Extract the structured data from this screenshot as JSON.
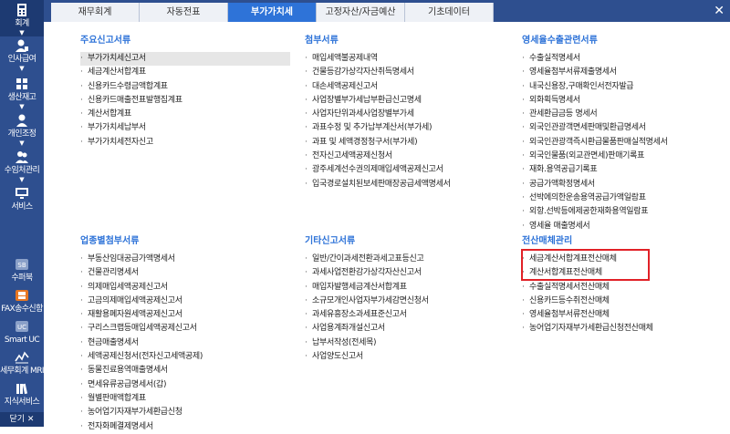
{
  "sidebar": {
    "items": [
      {
        "label": "회계",
        "icon": "calculator-icon"
      },
      {
        "label": "인사급여",
        "icon": "person-icon"
      },
      {
        "label": "생산재고",
        "icon": "grid-icon"
      },
      {
        "label": "개인조정",
        "icon": "user-icon"
      },
      {
        "label": "수임처관리",
        "icon": "people-icon"
      },
      {
        "label": "서비스",
        "icon": "monitor-icon"
      },
      {
        "label": "수퍼북",
        "icon": "sb-icon"
      },
      {
        "label": "FAX송수신함",
        "icon": "fax-icon"
      },
      {
        "label": "Smart UC",
        "icon": "uc-icon"
      },
      {
        "label": "세무회계 MRI",
        "icon": "chart-icon"
      },
      {
        "label": "지식서비스",
        "icon": "books-icon"
      }
    ],
    "close_label": "닫기 ✕"
  },
  "tabs": [
    {
      "label": "재무회계"
    },
    {
      "label": "자동전표"
    },
    {
      "label": "부가가치세"
    },
    {
      "label": "고정자산/자금예산"
    },
    {
      "label": "기초데이터"
    }
  ],
  "close_icon": "✕",
  "sections": {
    "main_report": {
      "title": "주요신고서류",
      "items": [
        "부가가치세신고서",
        "세금계산서합계표",
        "신용카드수령금액합계표",
        "신용카드매출전표발행집계표",
        "계산서합계표",
        "부가가치세납부서",
        "부가가치세전자신고"
      ]
    },
    "attachments": {
      "title": "첨부서류",
      "items": [
        "매입세액불공제내역",
        "건물등감가상각자산취득명세서",
        "대손세액공제신고서",
        "사업장별부가세납부환급신고명세",
        "사업자단위과세사업장별부가세",
        "과표수정 및 추가납부계산서(부가세)",
        "과표 및 세액경정청구서(부가세)",
        "전자신고세액공제신청서",
        "광주세계선수권의제매입세액공제신고서",
        "입국경로설치된보세판매장공급세액명세서"
      ]
    },
    "zero_rate": {
      "title": "영세율수출관련서류",
      "items": [
        "수출실적명세서",
        "영세율첨부서류제출명세서",
        "내국신용장,구매확인서전자발급",
        "외화획득명세서",
        "관세환급금등 명세서",
        "외국인관광객면세판매및환급명세서",
        "외국인관광객즉시환급물품판매실적명세서",
        "외국인물품(외교관면세)판매기록표",
        "재화.용역공급기록표",
        "공급가액확정명세서",
        "선박에의한운송용역공급가액일람표",
        "외항.선박등에제공한재화용역일람표",
        "영세율 매출명세서"
      ]
    },
    "industry": {
      "title": "업종별첨부서류",
      "items": [
        "부동산임대공급가액명세서",
        "건물관리명세서",
        "의제매입세액공제신고서",
        "고금의제매입세액공제신고서",
        "재활용폐자원세액공제신고서",
        "구리스크랩등매입세액공제신고서",
        "현금매출명세서",
        "세액공제신청서(전자신고세액공제)",
        "동물진료용역매출명세서",
        "면세유류공급명세서(갑)",
        "월별판매액합계표",
        "농어업기자재부가세환급신청",
        "전자화폐결제명세서"
      ]
    },
    "other": {
      "title": "기타신고서류",
      "items": [
        "일반/간이과세전환과세고표등신고",
        "과세사업전환감가상각자산신고서",
        "매입자발행세금계산서합계표",
        "소규모개인사업자부가세감면신청서",
        "과세유흥장소과세표준신고서",
        "사업용계좌개설신고서",
        "납부서작성(전세목)",
        "사업양도신고서"
      ]
    },
    "electronic": {
      "title": "전산매체관리",
      "items": [
        "세금계산서합계표전산매체",
        "계산서합계표전산매체",
        "수출실적명세서전산매체",
        "신용카드등수취전산매체",
        "영세율첨부서류전산매체",
        "농어업기자재부가세환급신청전산매체"
      ]
    }
  },
  "colors": {
    "sidebar": "#2e4f8f",
    "accent": "#2e73d8",
    "highlight": "#e12127"
  }
}
